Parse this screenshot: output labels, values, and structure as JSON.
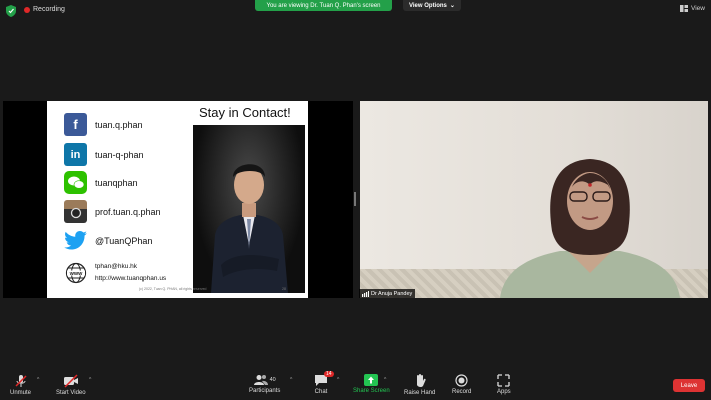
{
  "topbar": {
    "recording_label": "Recording",
    "banner_text": "You are viewing Dr. Tuan Q. Phan's screen",
    "view_options_label": "View Options",
    "view_label": "View"
  },
  "slide": {
    "title": "Stay in Contact!",
    "contacts": [
      {
        "icon": "facebook-icon",
        "text": "tuan.q.phan",
        "color": "#3b5998",
        "glyph": "f"
      },
      {
        "icon": "linkedin-icon",
        "text": "tuan-q-phan",
        "color": "#0e76a8",
        "glyph": "in"
      },
      {
        "icon": "wechat-icon",
        "text": "tuanqphan",
        "color": "#2dc100",
        "glyph": "✉"
      },
      {
        "icon": "instagram-icon",
        "text": "prof.tuan.q.phan",
        "color": "#8a6a4a",
        "glyph": "◎"
      },
      {
        "icon": "twitter-icon",
        "text": "@TuanQPhan",
        "color": "#1da1f2",
        "glyph": "🐦"
      }
    ],
    "email": "tphan@hku.hk",
    "website": "http://www.tuanqphan.us",
    "footer": "(c) 2022, Tuan Q. PHAN, all rights reserved",
    "page_number": "28"
  },
  "participant": {
    "name": "Dr Anuja Pandey"
  },
  "toolbar": {
    "unmute": "Unmute",
    "start_video": "Start Video",
    "participants": "Participants",
    "participants_count": "40",
    "chat": "Chat",
    "chat_badge": "14",
    "share_screen": "Share Screen",
    "raise_hand": "Raise Hand",
    "record": "Record",
    "apps": "Apps",
    "leave": "Leave"
  },
  "colors": {
    "banner_green": "#23a049",
    "leave_red": "#d33",
    "share_green": "#23c552"
  }
}
